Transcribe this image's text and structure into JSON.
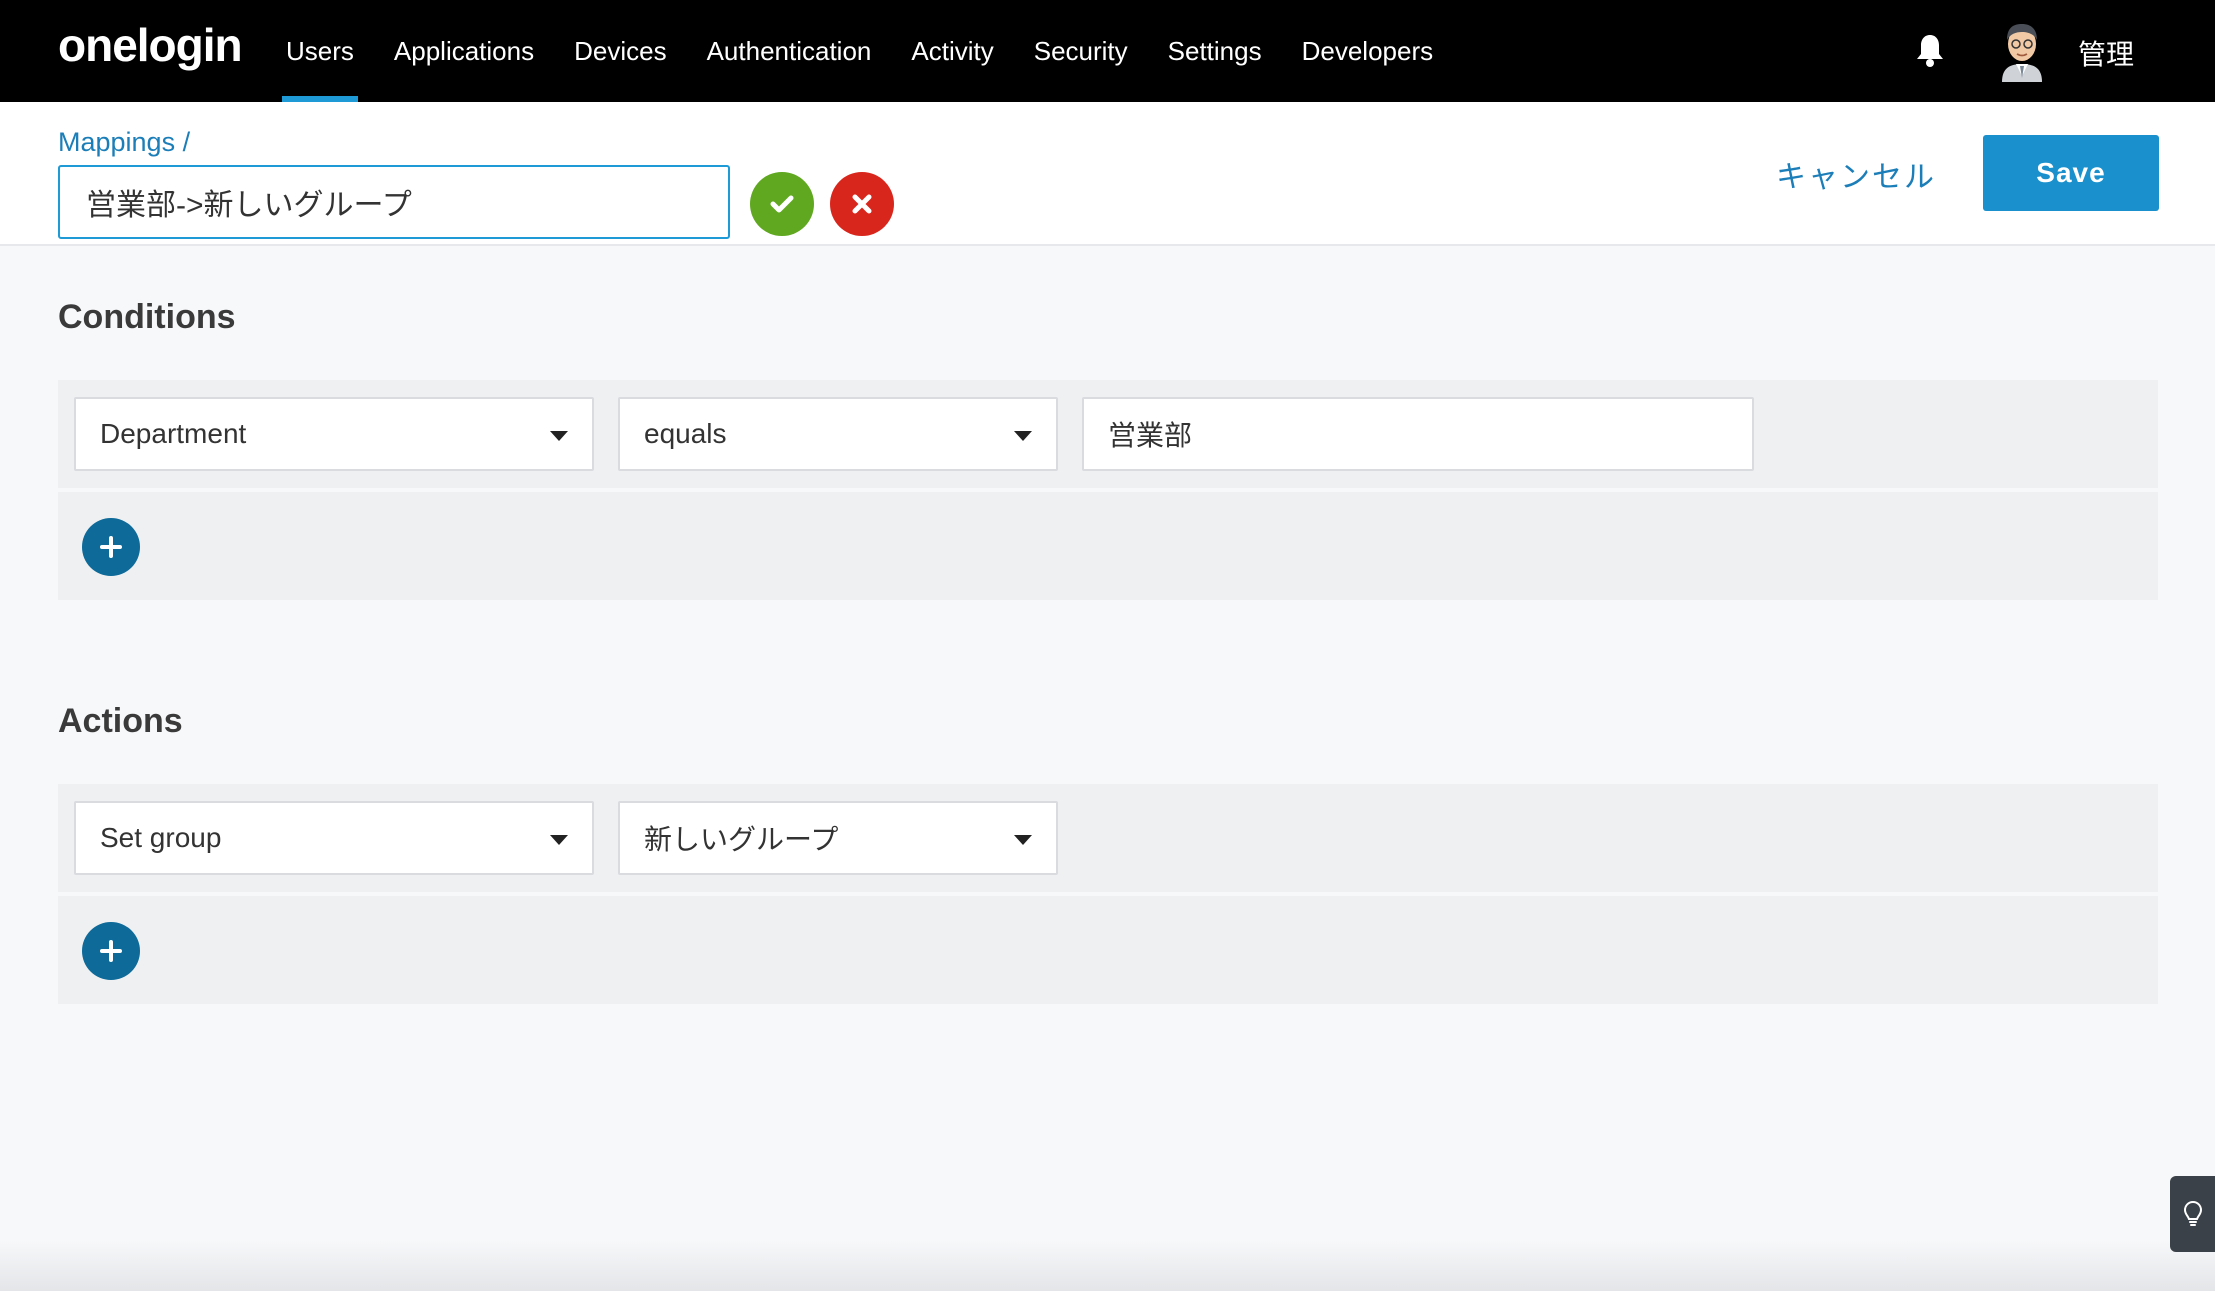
{
  "brand": {
    "logo": "onelogin"
  },
  "nav": {
    "items": [
      {
        "label": "Users",
        "active": true
      },
      {
        "label": "Applications",
        "active": false
      },
      {
        "label": "Devices",
        "active": false
      },
      {
        "label": "Authentication",
        "active": false
      },
      {
        "label": "Activity",
        "active": false
      },
      {
        "label": "Security",
        "active": false
      },
      {
        "label": "Settings",
        "active": false
      },
      {
        "label": "Developers",
        "active": false
      }
    ],
    "bell_icon": "bell-icon",
    "avatar_icon": "user-avatar",
    "user_name": "管理"
  },
  "header": {
    "breadcrumb": "Mappings /",
    "mapping_name": "営業部->新しいグループ",
    "confirm_icon": "check-icon",
    "discard_icon": "close-icon",
    "cancel_label": "キャンセル",
    "save_label": "Save"
  },
  "conditions": {
    "title": "Conditions",
    "rows": [
      {
        "field": "Department",
        "operator": "equals",
        "value": "営業部"
      }
    ],
    "add_icon": "plus-icon"
  },
  "actions": {
    "title": "Actions",
    "rows": [
      {
        "action": "Set group",
        "value": "新しいグループ"
      }
    ],
    "add_icon": "plus-icon"
  },
  "help": {
    "icon": "lightbulb-icon"
  },
  "colors": {
    "accent": "#1a90cc",
    "link": "#1c7eb8",
    "confirm": "#5fa820",
    "discard": "#d9261c",
    "add_button": "#0d6a99",
    "topbar": "#000000"
  }
}
